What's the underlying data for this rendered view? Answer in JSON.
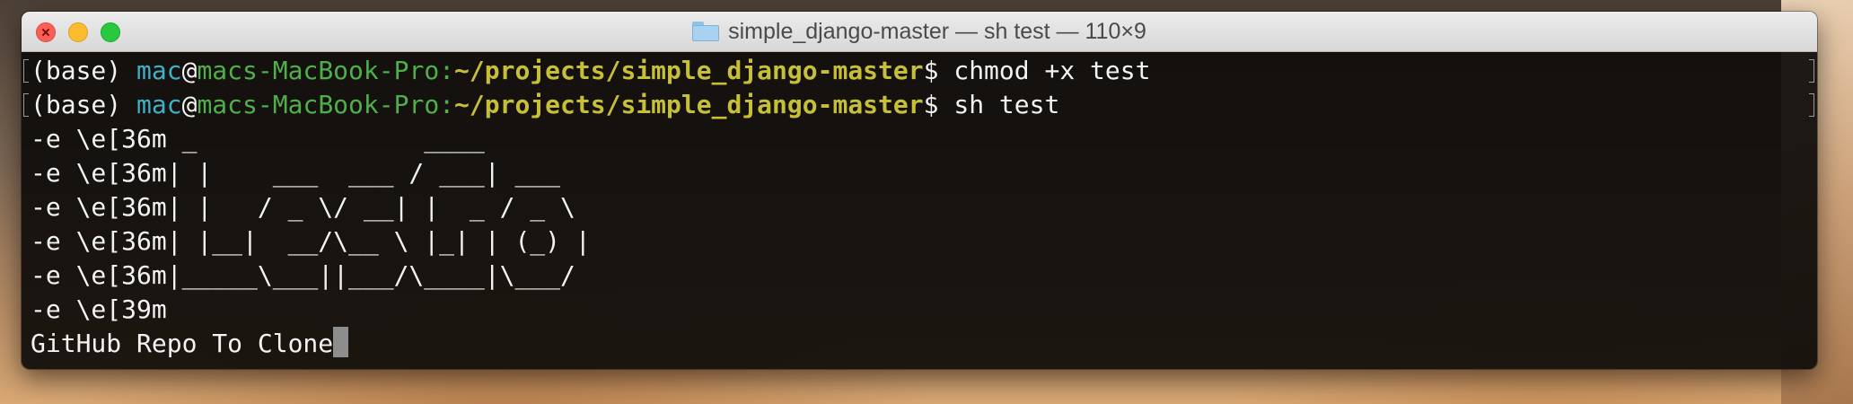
{
  "window": {
    "title": "simple_django-master — sh test — 110×9",
    "title_icon": "folder-icon",
    "controls": [
      "close",
      "minimize",
      "maximize"
    ]
  },
  "colors": {
    "terminal_bg": "#0e0c0a",
    "text": "#f3f3f3",
    "user": "#3fb1c7",
    "host": "#4fb04a",
    "path": "#c7bf38",
    "cursor": "#8d8d8d"
  },
  "terminal": {
    "prompt": {
      "env": "(base) ",
      "user": "mac",
      "at": "@",
      "host": "macs-MacBook-Pro",
      "colon": ":",
      "path": "~/projects/simple_django-master",
      "symbol": "$ "
    },
    "commands": [
      "chmod +x test",
      "sh test"
    ],
    "output": [
      "-e \\e[36m _               ____",
      "-e \\e[36m| |    ___  ___ / ___| ___",
      "-e \\e[36m| |   / _ \\/ __| |  _ / _ \\",
      "-e \\e[36m| |__|  __/\\__ \\ |_| | (_) |",
      "-e \\e[36m|_____\\___||___/\\____|\\___/",
      "-e \\e[39m",
      "GitHub Repo To Clone"
    ]
  }
}
